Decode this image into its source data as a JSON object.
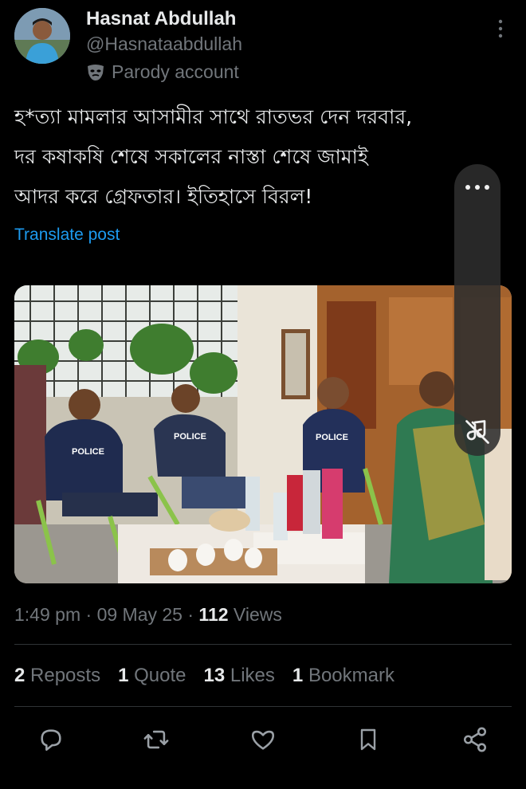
{
  "author": {
    "name": "Hasnat Abdullah",
    "handle": "@Hasnataabdullah",
    "label": "Parody account"
  },
  "post": {
    "lines": [
      "হ*ত্যা মামলার আসামীর সাথে রাতভর দেন দরবার,",
      "দর কষাকষি শেষে সকালের নাস্তা শেষে জামাই",
      "আদর করে গ্রেফতার। ইতিহাসে বিরল!"
    ],
    "translate_label": "Translate post"
  },
  "media": {
    "vest_texts": [
      "POLICE",
      "POLICE",
      "POLICE"
    ]
  },
  "meta": {
    "time": "1:49 pm",
    "date": "09 May 25",
    "views_count": "112",
    "views_label": "Views",
    "separator": "·"
  },
  "stats": {
    "reposts_count": "2",
    "reposts_label": "Reposts",
    "quotes_count": "1",
    "quotes_label": "Quote",
    "likes_count": "13",
    "likes_label": "Likes",
    "bookmarks_count": "1",
    "bookmarks_label": "Bookmark"
  },
  "icons": {
    "reply": "reply-icon",
    "repost": "repost-icon",
    "like": "heart-icon",
    "bookmark": "bookmark-icon",
    "share": "share-icon",
    "more": "more-icon",
    "mute": "mute-icon",
    "parody": "mask-icon"
  },
  "colors": {
    "background": "#000000",
    "text": "#e7e9ea",
    "muted": "#71767b",
    "link": "#1d9bf0"
  }
}
